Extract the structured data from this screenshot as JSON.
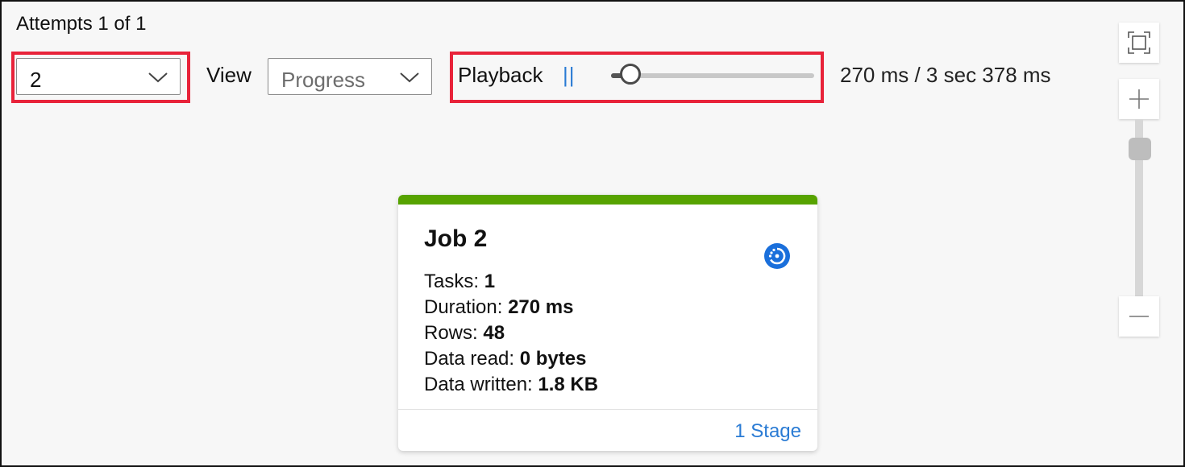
{
  "header": {
    "attempts_text": "Attempts 1 of 1"
  },
  "controls": {
    "attempt_select_value": "2",
    "view_label": "View",
    "view_select_value": "Progress",
    "playback_label": "Playback",
    "pause_glyph": "||",
    "playback_position": 0.08,
    "time_readout": "270 ms / 3 sec 378 ms"
  },
  "zoom": {
    "fit_icon": "fit-to-screen-icon",
    "plus_icon": "zoom-in-icon",
    "minus_icon": "zoom-out-icon",
    "level": 0.88
  },
  "job": {
    "title": "Job 2",
    "status_icon": "in-progress-icon",
    "accent_color": "#57a300",
    "stats": [
      {
        "label": "Tasks:",
        "value": "1"
      },
      {
        "label": "Duration:",
        "value": "270 ms"
      },
      {
        "label": "Rows:",
        "value": "48"
      },
      {
        "label": "Data read:",
        "value": "0 bytes"
      },
      {
        "label": "Data written:",
        "value": "1.8 KB"
      }
    ],
    "stage_link": "1 Stage"
  },
  "colors": {
    "highlight": "#e8233a",
    "link": "#2a7bd4"
  }
}
